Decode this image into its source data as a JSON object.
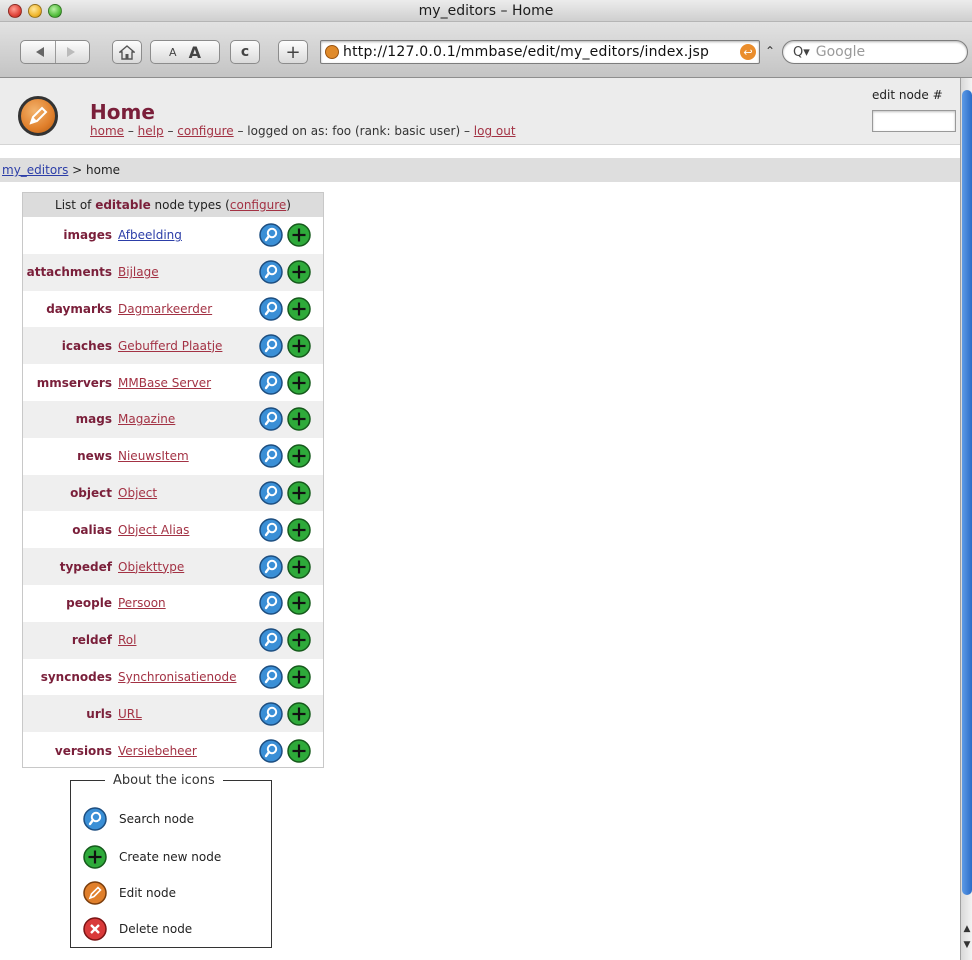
{
  "window": {
    "title": "my_editors – Home"
  },
  "toolbar": {
    "text_small": "A",
    "text_big": "A",
    "reload_glyph": "c",
    "add_glyph": "+",
    "url": "http://127.0.0.1/mmbase/edit/my_editors/index.jsp",
    "snapback_glyph": "↩",
    "caret_glyph": "⌃",
    "search_placeholder": "Google",
    "search_glyph": "Q▾"
  },
  "header": {
    "title": "Home",
    "links": {
      "home": "home",
      "help": "help",
      "configure": "configure",
      "logout": "log out"
    },
    "sep": " – ",
    "logged_on": " – logged on as: foo (rank: basic user) – ",
    "edit_node_label": "edit node #",
    "edit_node_value": ""
  },
  "breadcrumb": {
    "root": "my_editors",
    "sep": " > ",
    "current": "home"
  },
  "nodetypes": {
    "caption_prefix": "List of ",
    "caption_bold": "editable",
    "caption_middle": " node types (",
    "caption_link": "configure",
    "caption_suffix": ")",
    "rows": [
      {
        "name": "images",
        "gui": "Afbeelding"
      },
      {
        "name": "attachments",
        "gui": "Bijlage"
      },
      {
        "name": "daymarks",
        "gui": "Dagmarkeerder"
      },
      {
        "name": "icaches",
        "gui": "Gebufferd Plaatje"
      },
      {
        "name": "mmservers",
        "gui": "MMBase Server"
      },
      {
        "name": "mags",
        "gui": "Magazine"
      },
      {
        "name": "news",
        "gui": "NieuwsItem"
      },
      {
        "name": "object",
        "gui": "Object"
      },
      {
        "name": "oalias",
        "gui": "Object Alias"
      },
      {
        "name": "typedef",
        "gui": "Objekttype"
      },
      {
        "name": "people",
        "gui": "Persoon"
      },
      {
        "name": "reldef",
        "gui": "Rol"
      },
      {
        "name": "syncnodes",
        "gui": "Synchronisatienode"
      },
      {
        "name": "urls",
        "gui": "URL"
      },
      {
        "name": "versions",
        "gui": "Versiebeheer"
      }
    ]
  },
  "legend": {
    "title": "About the icons",
    "items": {
      "search": "Search node",
      "create": "Create new node",
      "edit": "Edit node",
      "delete": "Delete node"
    }
  },
  "colors": {
    "title": "#7a1f3a",
    "link": "#a33244",
    "visited_link": "#2c3ea8",
    "search_icon": "#3a8fd6",
    "create_icon": "#2eaa3a",
    "edit_icon": "#e07f2b",
    "delete_icon": "#d93a3a"
  }
}
